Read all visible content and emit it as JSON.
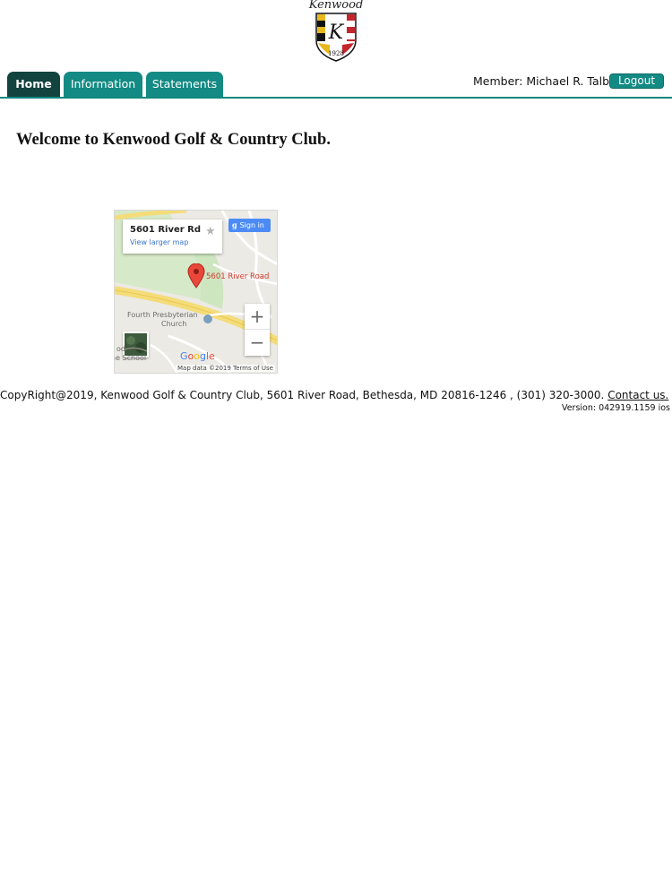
{
  "logo": {
    "word": "Kenwood",
    "letter": "K",
    "year": "1928"
  },
  "nav": {
    "tabs": [
      {
        "label": "Home",
        "active": true
      },
      {
        "label": "Information",
        "active": false
      },
      {
        "label": "Statements",
        "active": false
      }
    ],
    "member_text": "Member: Michael R. Talbot",
    "logout_label": "Logout"
  },
  "welcome": "Welcome to Kenwood Golf & Country Club.",
  "map": {
    "card_title": "5601 River Rd",
    "larger_map_link": "View larger map",
    "sign_in_label": "Sign in",
    "pin_label": "5601 River Road",
    "church_label_line1": "Fourth Presbyterian",
    "church_label_line2": "Church",
    "school_label_line1": "od",
    "school_label_line2": "he School",
    "attribution": "Map data ©2019  Terms of Use",
    "zoom_in": "+",
    "zoom_out": "−"
  },
  "footer": {
    "copyright": "CopyRight@2019, Kenwood Golf & Country Club, 5601 River Road, Bethesda, MD 20816-1246 , (301) 320-3000.",
    "contact_link": "Contact us.",
    "version": "Version: 042919.1159 ios"
  },
  "colors": {
    "tab_active": "#13433f",
    "tab_inactive": "#138a83",
    "nav_rule": "#11877f",
    "map_pin": "#d03a2c"
  }
}
